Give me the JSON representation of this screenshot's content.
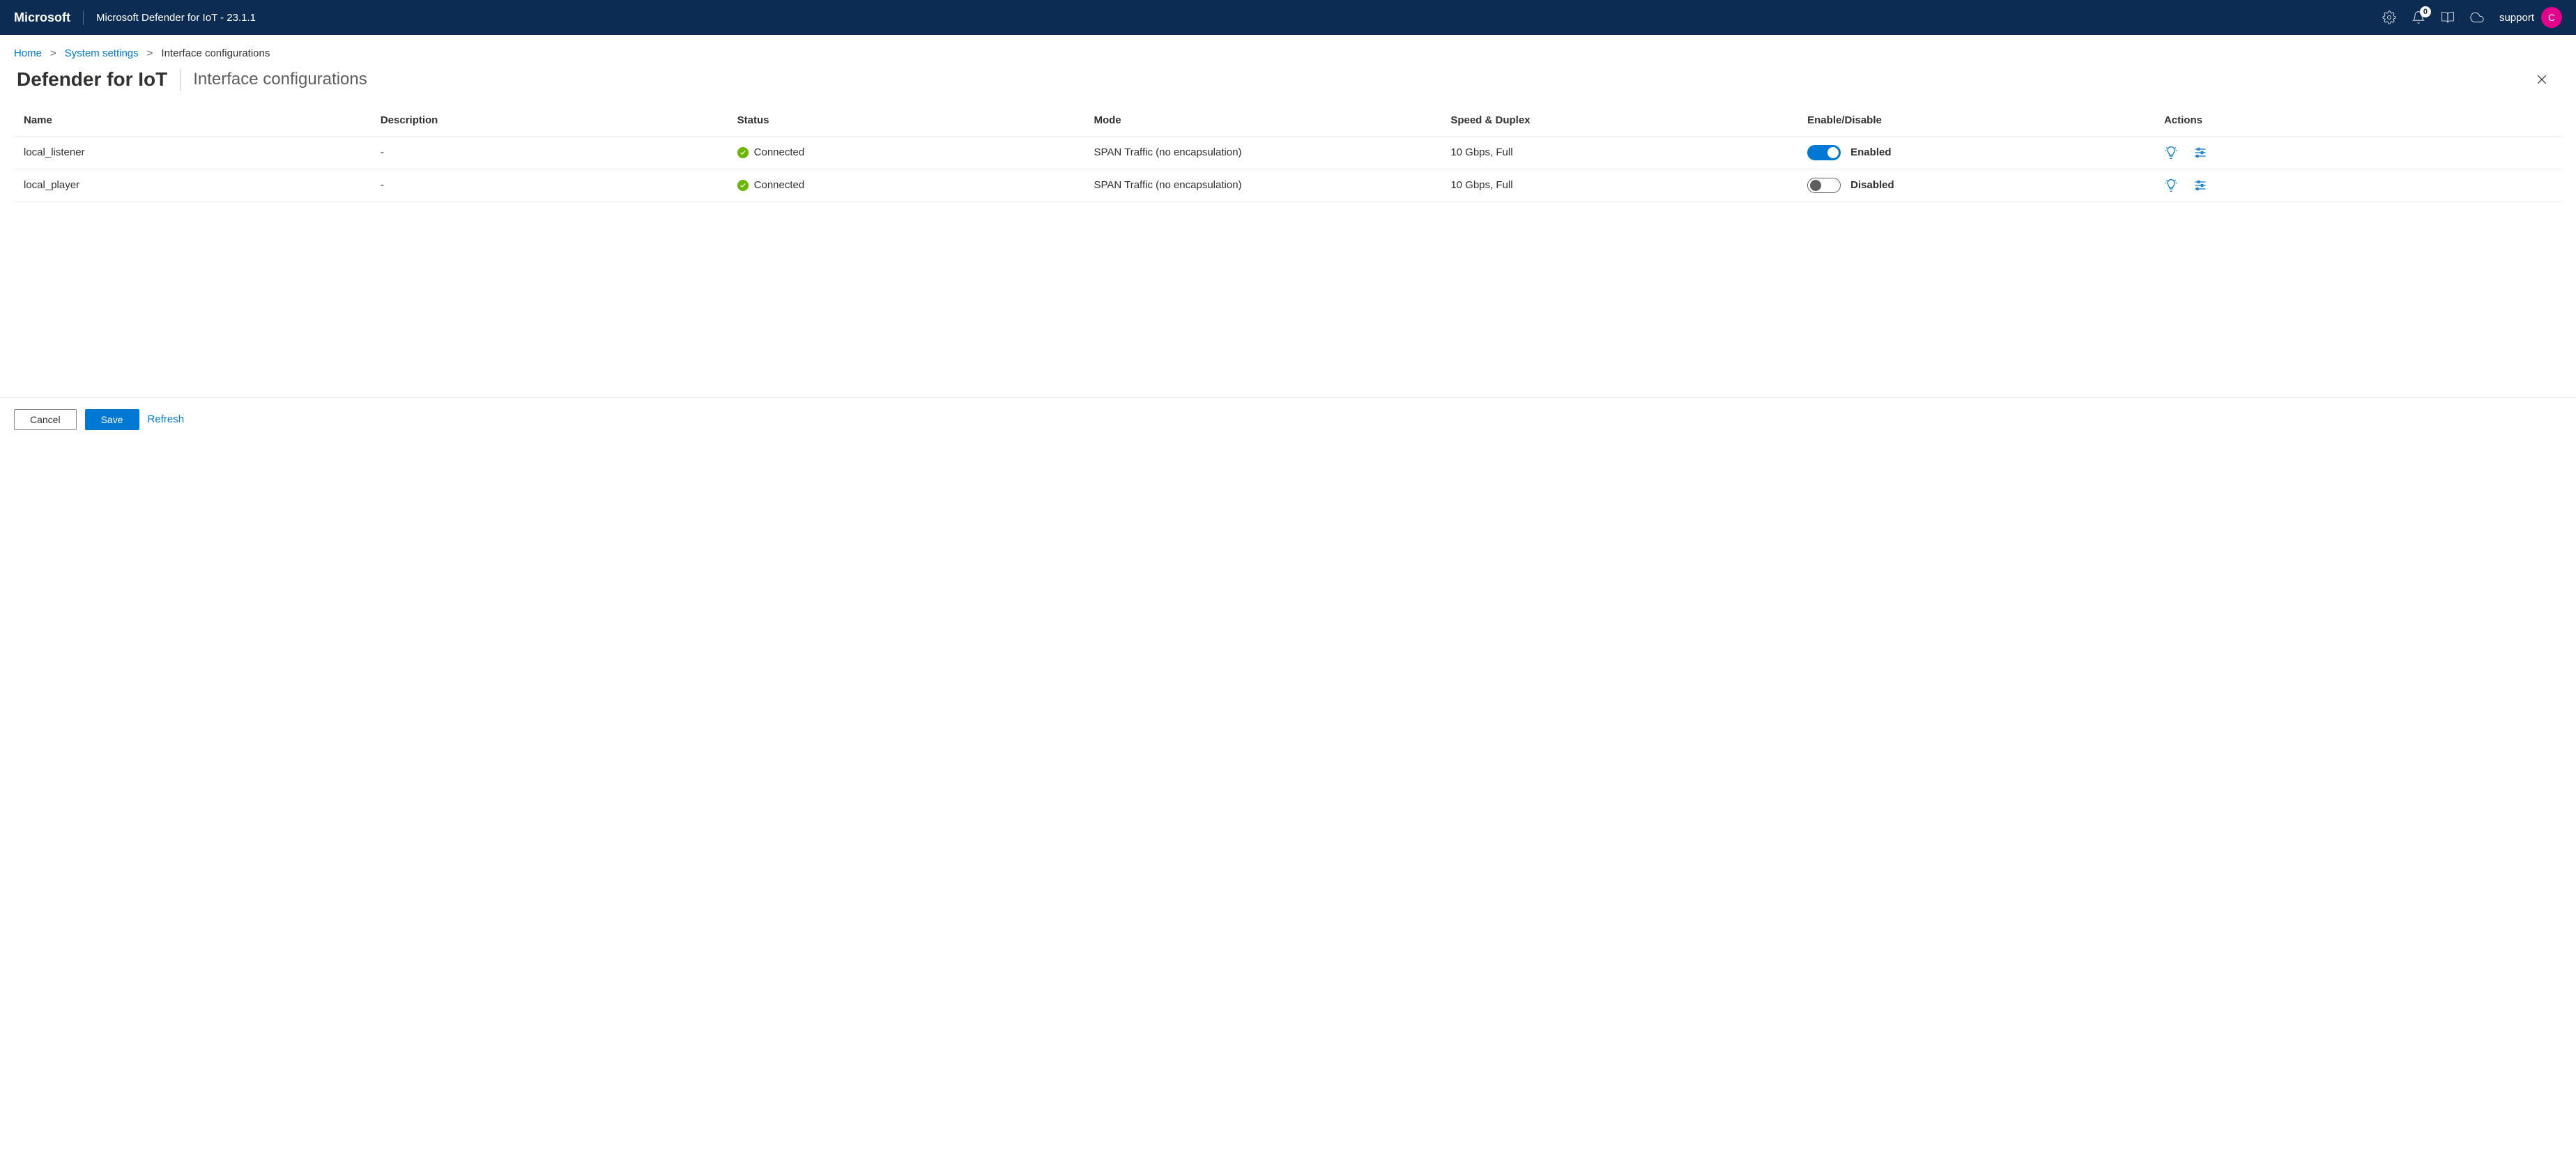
{
  "header": {
    "brand": "Microsoft",
    "title": "Microsoft Defender for IoT - 23.1.1",
    "notificationCount": "0",
    "userName": "support",
    "avatarInitial": "C"
  },
  "breadcrumbs": {
    "items": [
      {
        "label": "Home",
        "link": true
      },
      {
        "label": "System settings",
        "link": true
      },
      {
        "label": "Interface configurations",
        "link": false
      }
    ]
  },
  "page": {
    "product": "Defender for IoT",
    "subtitle": "Interface configurations"
  },
  "table": {
    "columns": {
      "name": "Name",
      "description": "Description",
      "status": "Status",
      "mode": "Mode",
      "speed": "Speed & Duplex",
      "enable": "Enable/Disable",
      "actions": "Actions"
    },
    "rows": [
      {
        "name": "local_listener",
        "description": "-",
        "status": "Connected",
        "mode": "SPAN Traffic (no encapsulation)",
        "speed": "10 Gbps, Full",
        "enabled": true,
        "enabledLabel": "Enabled"
      },
      {
        "name": "local_player",
        "description": "-",
        "status": "Connected",
        "mode": "SPAN Traffic (no encapsulation)",
        "speed": "10 Gbps, Full",
        "enabled": false,
        "enabledLabel": "Disabled"
      }
    ]
  },
  "footer": {
    "cancel": "Cancel",
    "save": "Save",
    "refresh": "Refresh"
  }
}
